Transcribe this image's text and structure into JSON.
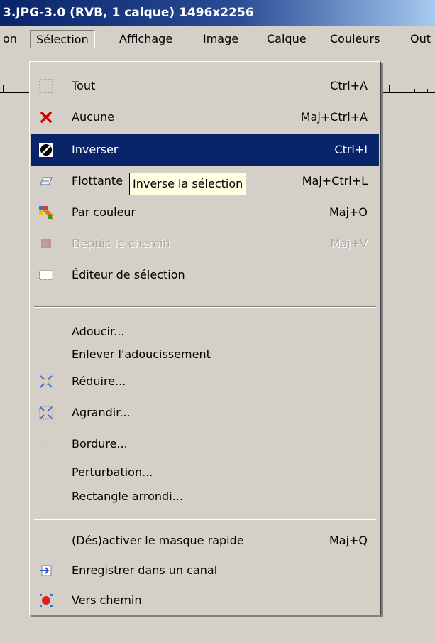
{
  "window": {
    "title": "3.JPG-3.0 (RVB, 1 calque) 1496x2256"
  },
  "menubar": {
    "items": [
      {
        "label": "on"
      },
      {
        "label": "Sélection"
      },
      {
        "label": "Affichage"
      },
      {
        "label": "Image"
      },
      {
        "label": "Calque"
      },
      {
        "label": "Couleurs"
      },
      {
        "label": "Out"
      }
    ]
  },
  "menu": {
    "items": [
      {
        "label": "Tout",
        "shortcut": "Ctrl+A",
        "icon": "select-all-icon"
      },
      {
        "label": "Aucune",
        "shortcut": "Maj+Ctrl+A",
        "icon": "select-none-icon"
      },
      {
        "label": "Inverser",
        "shortcut": "Ctrl+I",
        "icon": "invert-selection-icon"
      },
      {
        "label": "Flottante",
        "shortcut": "Maj+Ctrl+L",
        "icon": "floating-selection-icon"
      },
      {
        "label": "Par couleur",
        "shortcut": "Maj+O",
        "icon": "select-by-color-icon"
      },
      {
        "label": "Depuis le chemin",
        "shortcut": "Maj+V",
        "icon": "selection-from-path-icon",
        "disabled": true
      },
      {
        "label": "Éditeur de sélection",
        "shortcut": "",
        "icon": "selection-editor-icon"
      },
      {
        "label": "Adoucir...",
        "shortcut": ""
      },
      {
        "label": "Enlever l'adoucissement",
        "shortcut": ""
      },
      {
        "label": "Réduire...",
        "shortcut": "",
        "icon": "shrink-selection-icon"
      },
      {
        "label": "Agrandir...",
        "shortcut": "",
        "icon": "grow-selection-icon"
      },
      {
        "label": "Bordure...",
        "shortcut": "",
        "icon": "border-selection-icon"
      },
      {
        "label": "Perturbation...",
        "shortcut": ""
      },
      {
        "label": "Rectangle arrondi...",
        "shortcut": ""
      },
      {
        "label": "(Dés)activer le masque rapide",
        "shortcut": "Maj+Q"
      },
      {
        "label": "Enregistrer dans un canal",
        "shortcut": "",
        "icon": "save-to-channel-icon"
      },
      {
        "label": "Vers chemin",
        "shortcut": "",
        "icon": "to-path-icon"
      }
    ],
    "highlighted": "Inverser"
  },
  "tooltip": {
    "text": "Inverse la sélection"
  },
  "colors": {
    "highlight": "#0a246a",
    "menu_bg": "#d4d0c8",
    "tooltip_bg": "#ffffe1",
    "none_icon_red": "#cc0000"
  }
}
